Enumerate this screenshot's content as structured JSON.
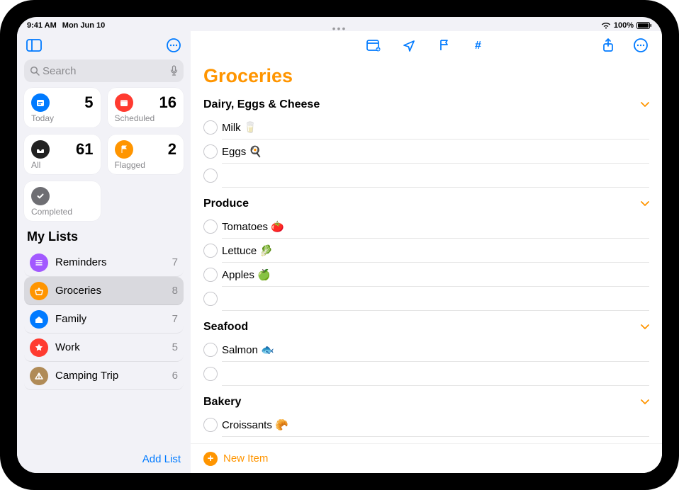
{
  "status": {
    "time": "9:41 AM",
    "date": "Mon Jun 10",
    "battery": "100%"
  },
  "sidebar": {
    "search_placeholder": "Search",
    "cards": {
      "today": {
        "label": "Today",
        "count": "5"
      },
      "scheduled": {
        "label": "Scheduled",
        "count": "16"
      },
      "all": {
        "label": "All",
        "count": "61"
      },
      "flagged": {
        "label": "Flagged",
        "count": "2"
      },
      "completed": {
        "label": "Completed"
      }
    },
    "my_lists_title": "My Lists",
    "lists": [
      {
        "name": "Reminders",
        "count": "7",
        "color": "#a259ff",
        "icon": "list"
      },
      {
        "name": "Groceries",
        "count": "8",
        "color": "#ff9500",
        "icon": "basket",
        "selected": true
      },
      {
        "name": "Family",
        "count": "7",
        "color": "#007aff",
        "icon": "house"
      },
      {
        "name": "Work",
        "count": "5",
        "color": "#ff3b30",
        "icon": "star"
      },
      {
        "name": "Camping Trip",
        "count": "6",
        "color": "#b08b57",
        "icon": "tent"
      }
    ],
    "add_list_label": "Add List"
  },
  "main": {
    "title": "Groceries",
    "sections": [
      {
        "name": "Dairy, Eggs & Cheese",
        "items": [
          "Milk 🥛",
          "Eggs 🍳",
          ""
        ]
      },
      {
        "name": "Produce",
        "items": [
          "Tomatoes 🍅",
          "Lettuce 🥬",
          "Apples 🍏",
          ""
        ]
      },
      {
        "name": "Seafood",
        "items": [
          "Salmon 🐟",
          ""
        ]
      },
      {
        "name": "Bakery",
        "items": [
          "Croissants 🥐"
        ]
      }
    ],
    "new_item_label": "New Item"
  }
}
